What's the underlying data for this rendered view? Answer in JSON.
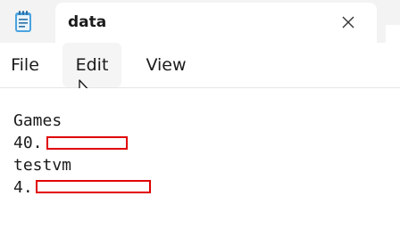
{
  "window": {
    "tab_title": "data",
    "app_icon": "notepad-icon",
    "close_icon": "close-icon"
  },
  "menu": {
    "file": "File",
    "edit": "Edit",
    "view": "View"
  },
  "editor": {
    "lines": [
      "Games",
      "40.",
      "testvm",
      "4."
    ]
  },
  "colors": {
    "titlebar_bg": "#f3f3f3",
    "redaction_border": "#e00000",
    "text": "#1b1b1b"
  }
}
